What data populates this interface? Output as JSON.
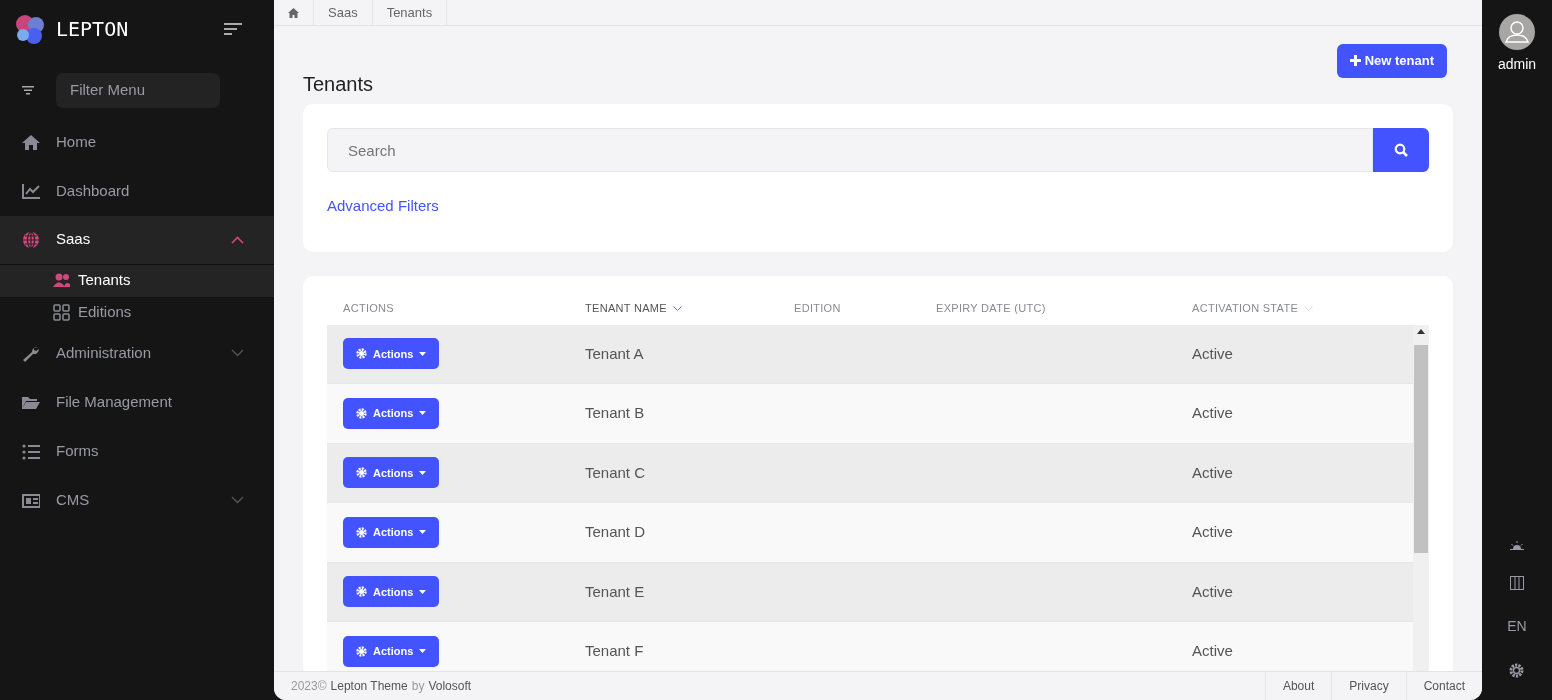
{
  "brand": {
    "name": "LEPTON"
  },
  "sidebar": {
    "filter": {
      "placeholder": "Filter Menu"
    },
    "items": [
      {
        "label": "Home",
        "selected": false
      },
      {
        "label": "Dashboard",
        "selected": false
      },
      {
        "label": "Saas",
        "selected": true,
        "expanded": true,
        "children": [
          {
            "label": "Tenants",
            "selected": true
          },
          {
            "label": "Editions",
            "selected": false
          }
        ]
      },
      {
        "label": "Administration",
        "selected": false,
        "expanded": false
      },
      {
        "label": "File Management",
        "selected": false
      },
      {
        "label": "Forms",
        "selected": false
      },
      {
        "label": "CMS",
        "selected": false,
        "expanded": false
      }
    ]
  },
  "breadcrumb": [
    "Saas",
    "Tenants"
  ],
  "page": {
    "title": "Tenants",
    "new_button": "New tenant"
  },
  "search": {
    "placeholder": "Search",
    "advanced_link": "Advanced Filters"
  },
  "table": {
    "columns": [
      {
        "label": "ACTIONS"
      },
      {
        "label": "TENANT NAME",
        "sortable": true,
        "sorted": true
      },
      {
        "label": "EDITION"
      },
      {
        "label": "EXPIRY DATE (UTC)"
      },
      {
        "label": "ACTIVATION STATE",
        "sortable": true,
        "sorted": false
      }
    ],
    "rows": [
      {
        "action": "Actions",
        "name": "Tenant A",
        "state": "Active"
      },
      {
        "action": "Actions",
        "name": "Tenant B",
        "state": "Active"
      },
      {
        "action": "Actions",
        "name": "Tenant C",
        "state": "Active"
      },
      {
        "action": "Actions",
        "name": "Tenant D",
        "state": "Active"
      },
      {
        "action": "Actions",
        "name": "Tenant E",
        "state": "Active"
      },
      {
        "action": "Actions",
        "name": "Tenant F",
        "state": "Active"
      }
    ]
  },
  "footer": {
    "year": "2023©",
    "theme_link": "Lepton Theme",
    "by": "by",
    "company_link": "Volosoft",
    "links": [
      "About",
      "Privacy",
      "Contact"
    ]
  },
  "user": {
    "name": "admin"
  },
  "toolbar": {
    "language": "EN"
  }
}
